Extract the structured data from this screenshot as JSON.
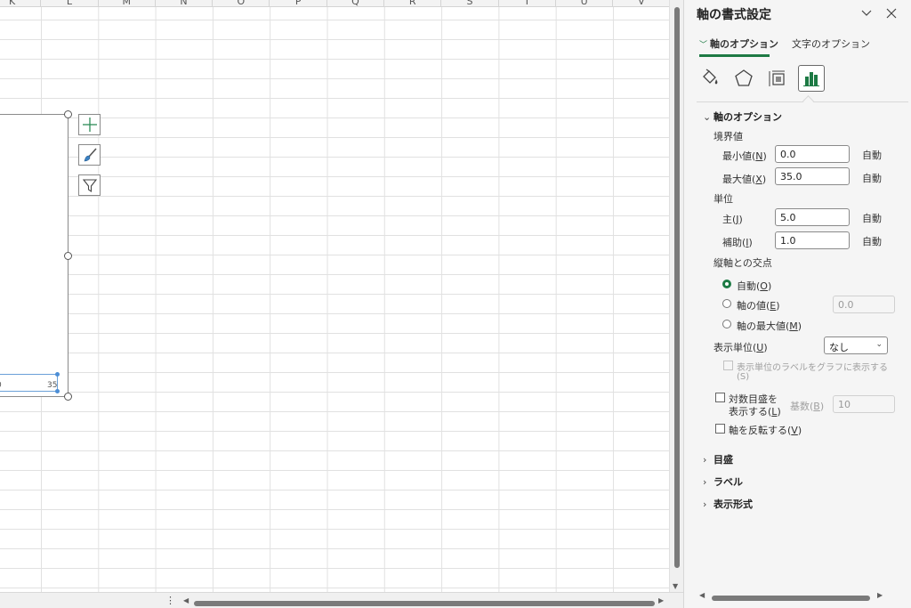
{
  "sheet": {
    "columns": [
      "K",
      "L",
      "M",
      "N",
      "O",
      "P",
      "Q",
      "R",
      "S",
      "T",
      "U",
      "V"
    ],
    "chart": {
      "axis_tick_labels": [
        "0",
        "35"
      ]
    }
  },
  "icons": {
    "add_element": "plus-icon",
    "chart_styles": "brush-icon",
    "chart_filter": "filter-icon",
    "fill_line": "paint-bucket-icon",
    "effects": "pentagon-icon",
    "size_properties": "size-properties-icon",
    "axis_options": "bar-chart-icon"
  },
  "colors": {
    "accent": "#1d7a44"
  },
  "pane": {
    "title": "軸の書式設定",
    "tabs": {
      "axis": "軸のオプション",
      "text": "文字のオプション"
    },
    "axis_section": "軸のオプション",
    "bounds_header": "境界値",
    "min_label": "最小値(",
    "min_key": "N",
    "min_value": "0.0",
    "max_label": "最大値(",
    "max_key": "X",
    "max_value": "35.0",
    "auto": "自動",
    "units_header": "単位",
    "major_label": "主(",
    "major_key": "J",
    "major_value": "5.0",
    "minor_label": "補助(",
    "minor_key": "I",
    "minor_value": "1.0",
    "cross_header": "縦軸との交点",
    "cross_auto": "自動(",
    "cross_auto_key": "O",
    "cross_value_label": "軸の値(",
    "cross_value_key": "E",
    "cross_value": "0.0",
    "cross_max": "軸の最大値(",
    "cross_max_key": "M",
    "display_units_label": "表示単位(",
    "display_units_key": "U",
    "display_units_value": "なし",
    "show_units_label_line1": "表示単位のラベルをグラフに表示する",
    "show_units_label_line2": "(S)",
    "log_scale_line1": "対数目盛を",
    "log_scale_line2": "表示する(",
    "log_scale_key": "L",
    "base_label": "基数(",
    "base_key": "B",
    "base_value": "10",
    "reverse_label": "軸を反転する(",
    "reverse_key": "V",
    "sections": [
      "目盛",
      "ラベル",
      "表示形式"
    ]
  }
}
